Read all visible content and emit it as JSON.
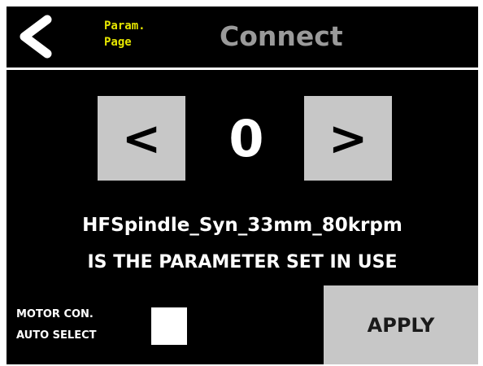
{
  "header": {
    "back_icon": "chevron-left-icon",
    "param_page_link": {
      "line1": "Param.",
      "line2": "Page"
    },
    "title": "Connect"
  },
  "parameter_selector": {
    "prev_label": "<",
    "next_label": ">",
    "index": "0"
  },
  "parameter_info": {
    "name": "HFSpindle_Syn_33mm_80krpm",
    "status": "IS THE PARAMETER SET IN USE"
  },
  "auto_select": {
    "label_line1": "MOTOR CON.",
    "label_line2": "AUTO SELECT",
    "checked": false
  },
  "apply": {
    "label": "APPLY"
  },
  "colors": {
    "background": "#000000",
    "header_divider": "#ffffff",
    "param_link": "#e6e600",
    "title": "#9a9a9a",
    "button_bg": "#c7c7c7",
    "text": "#ffffff"
  }
}
